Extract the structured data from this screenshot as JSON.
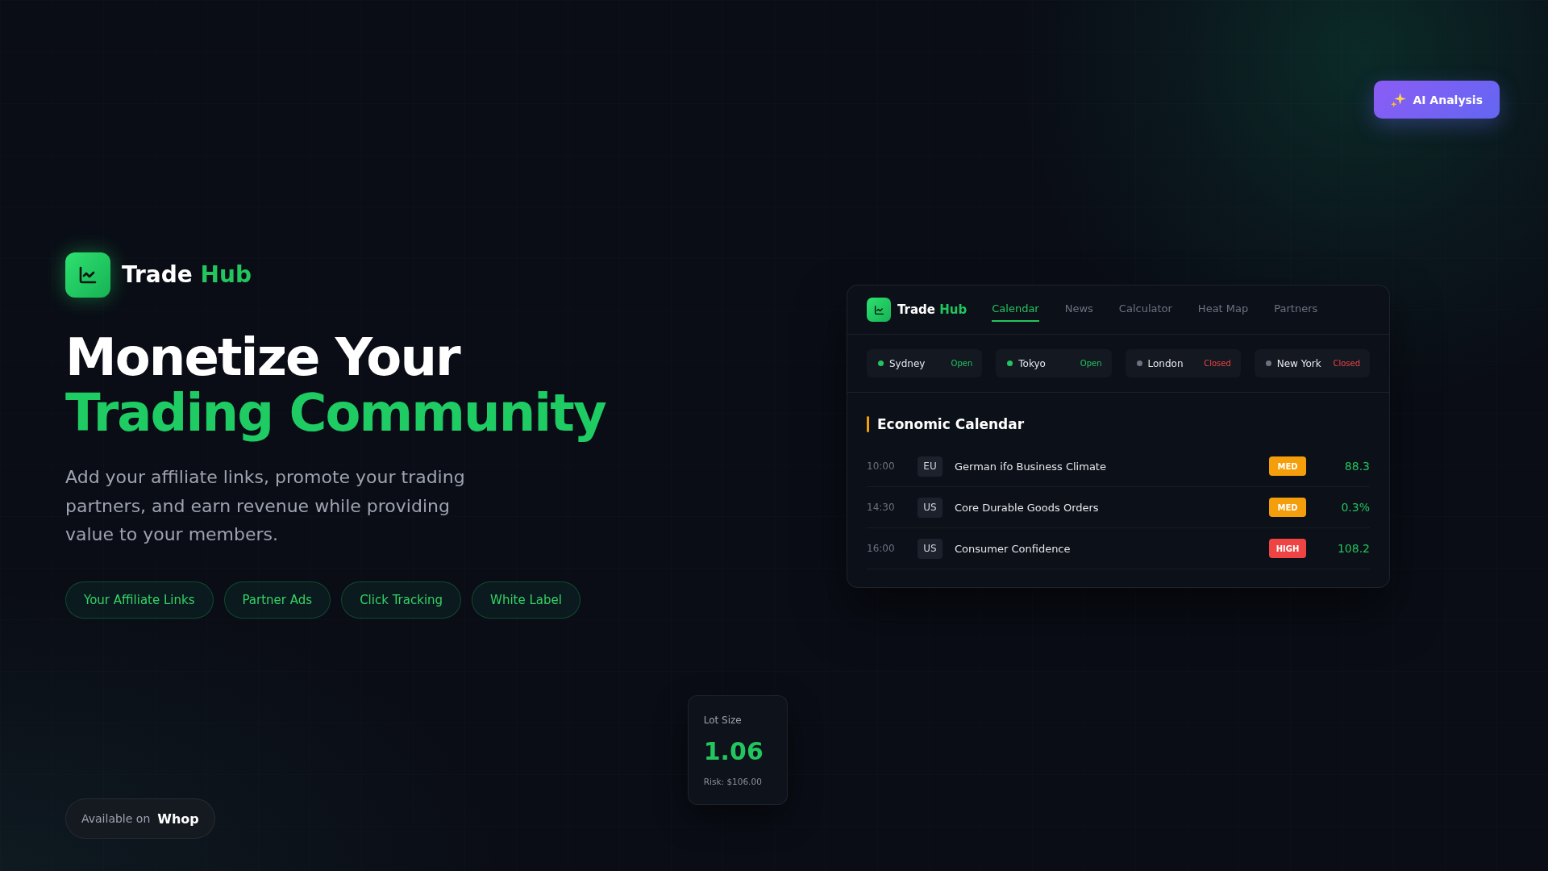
{
  "ai_button": {
    "label": "AI Analysis"
  },
  "hero": {
    "brand": {
      "name": "Trade",
      "accent": "Hub"
    },
    "headline": {
      "line_1": "Monetize Your",
      "line_2": "Trading Community"
    },
    "description": "Add your affiliate links, promote your trading partners, and earn revenue while providing value to your members.",
    "features": [
      "Your Affiliate Links",
      "Partner Ads",
      "Click Tracking",
      "White Label"
    ]
  },
  "dashboard": {
    "brand": {
      "name": "Trade",
      "accent": "Hub"
    },
    "tabs": [
      {
        "label": "Calendar",
        "selected": true
      },
      {
        "label": "News",
        "selected": false
      },
      {
        "label": "Calculator",
        "selected": false
      },
      {
        "label": "Heat Map",
        "selected": false
      },
      {
        "label": "Partners",
        "selected": false
      }
    ],
    "sessions": [
      {
        "city": "Sydney",
        "status": "Open",
        "open": true
      },
      {
        "city": "Tokyo",
        "status": "Open",
        "open": true
      },
      {
        "city": "London",
        "status": "Closed",
        "open": false
      },
      {
        "city": "New York",
        "status": "Closed",
        "open": false
      }
    ],
    "calendar": {
      "title": "Economic Calendar",
      "events": [
        {
          "time": "10:00",
          "country": "EU",
          "name": "German ifo Business Climate",
          "impact": "MED",
          "color": "#f59e0b",
          "value": "88.3"
        },
        {
          "time": "14:30",
          "country": "US",
          "name": "Core Durable Goods Orders",
          "impact": "MED",
          "color": "#f59e0b",
          "value": "0.3%"
        },
        {
          "time": "16:00",
          "country": "US",
          "name": "Consumer Confidence",
          "impact": "HIGH",
          "color": "#ef4444",
          "value": "108.2"
        }
      ]
    }
  },
  "lot_size": {
    "label": "Lot Size",
    "value": "1.06",
    "risk": "Risk: $106.00"
  },
  "availability": {
    "label": "Available on",
    "platform": "Whop"
  }
}
